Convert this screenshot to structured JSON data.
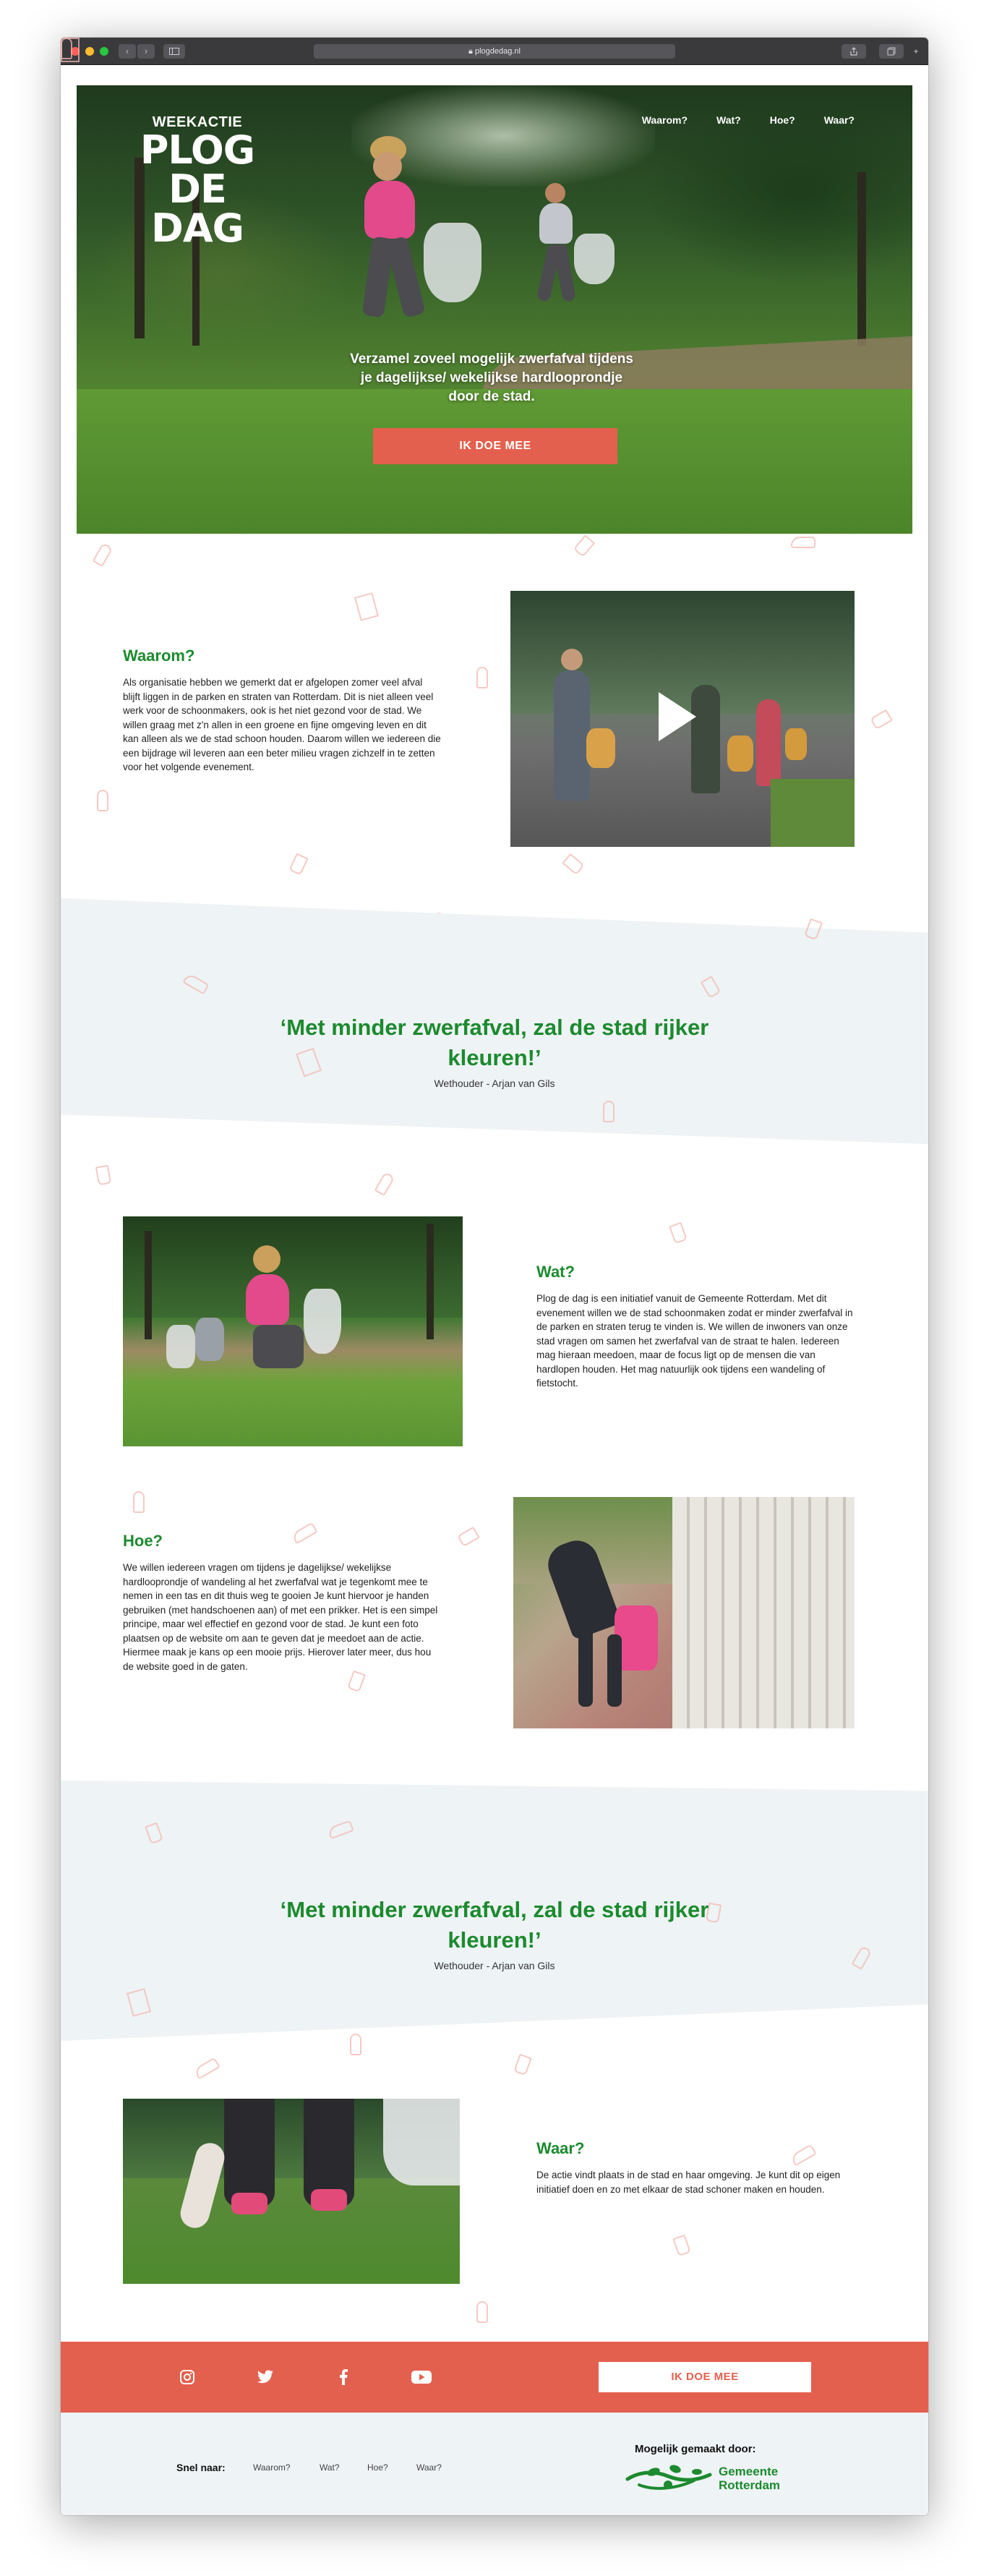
{
  "browser": {
    "url": "plogdedag.nl",
    "back": "‹",
    "forward": "›"
  },
  "hero": {
    "kicker": "WEEKACTIE",
    "logo_line1": "PLOG",
    "logo_line2": "DE DAG",
    "nav": [
      "Waarom?",
      "Wat?",
      "Hoe?",
      "Waar?"
    ],
    "tagline": "Verzamel zoveel mogelijk zwerfafval tijdens je dagelijkse/ wekelijkse hardlooprondje door de stad.",
    "cta": "IK DOE MEE"
  },
  "waarom": {
    "title": "Waarom?",
    "text": "Als organisatie hebben we gemerkt dat er afgelopen zomer veel afval blijft liggen in de parken en straten van Rotterdam. Dit is niet alleen veel werk voor de schoonmakers, ook is het niet gezond voor de stad. We willen graag met z'n allen in een groene en fijne omgeving leven en dit kan alleen als we de stad schoon houden. Daarom willen we iedereen die een bijdrage wil leveren aan een beter milieu vragen zichzelf in te zetten voor het volgende evenement."
  },
  "quote1": {
    "text": "‘Met minder zwerfafval, zal de stad rijker kleuren!’",
    "author": "Wethouder - Arjan van Gils"
  },
  "wat": {
    "title": "Wat?",
    "text": "Plog de dag is een initiatief vanuit de Gemeente Rotterdam. Met dit evenement willen we de stad schoonmaken zodat er minder zwerfafval in de parken en straten terug te vinden is. We willen de inwoners van onze stad vragen om samen het zwerfafval van de straat te halen. Iedereen mag hieraan meedoen, maar de focus ligt op de mensen die van hardlopen houden. Het mag natuurlijk ook tijdens een wandeling of fietstocht."
  },
  "hoe": {
    "title": "Hoe?",
    "text": "We willen iedereen vragen om tijdens je dagelijkse/ wekelijkse hardlooprondje of wandeling al het zwerfafval wat je tegenkomt mee te nemen in een tas en dit thuis weg te gooien Je kunt hiervoor je handen gebruiken (met handschoenen aan) of met een prikker. Het is een simpel principe, maar wel effectief en gezond voor de stad. Je kunt een foto plaatsen op de website om aan te geven dat je meedoet aan de actie. Hiermee maak je kans op een mooie prijs. Hierover later meer, dus hou de website goed in de gaten."
  },
  "quote2": {
    "text": "‘Met minder zwerfafval, zal de stad rijker kleuren!’",
    "author": "Wethouder - Arjan van Gils"
  },
  "waar": {
    "title": "Waar?",
    "text": "De actie vindt plaats in de stad en haar omgeving. Je kunt dit op eigen initiatief doen en zo met elkaar de stad schoner maken en houden."
  },
  "footer": {
    "cta": "IK DOE MEE",
    "snel_label": "Snel naar:",
    "links": [
      "Waarom?",
      "Wat?",
      "Hoe?",
      "Waar?"
    ],
    "made_by": "Mogelijk gemaakt door:",
    "sponsor_line1": "Gemeente",
    "sponsor_line2": "Rotterdam",
    "social_icons": [
      "instagram-icon",
      "twitter-icon",
      "facebook-icon",
      "youtube-icon"
    ]
  },
  "colors": {
    "accent": "#e4604e",
    "green": "#1c8a2e",
    "band": "#eef3f5"
  }
}
